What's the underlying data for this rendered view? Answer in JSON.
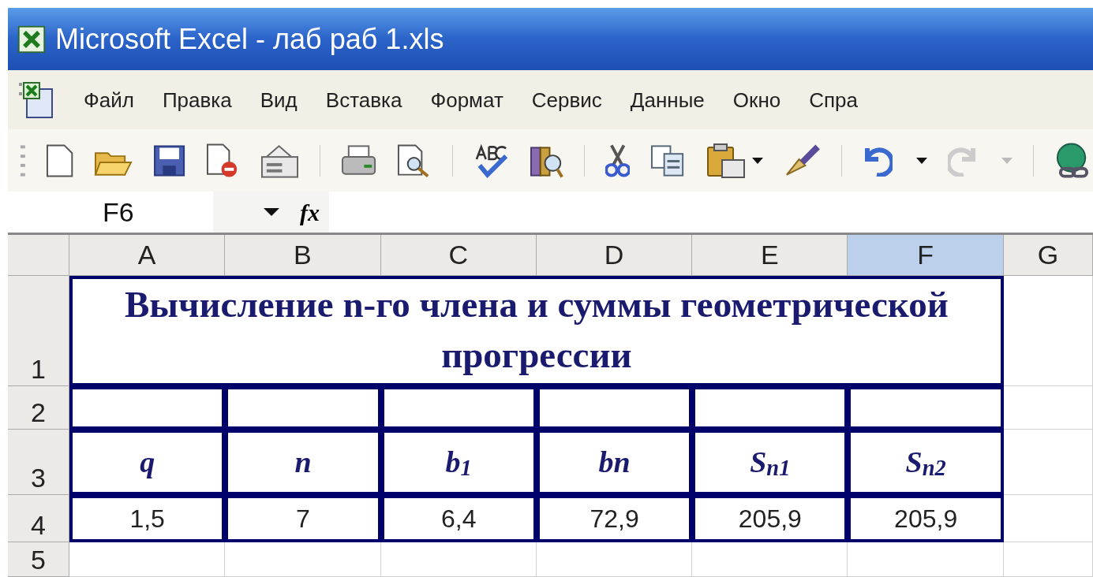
{
  "window": {
    "title": "Microsoft Excel - лаб раб 1.xls"
  },
  "menu": [
    {
      "label": "Файл"
    },
    {
      "label": "Правка"
    },
    {
      "label": "Вид"
    },
    {
      "label": "Вставка"
    },
    {
      "label": "Формат"
    },
    {
      "label": "Сервис"
    },
    {
      "label": "Данные"
    },
    {
      "label": "Окно"
    },
    {
      "label": "Спра"
    }
  ],
  "formula_bar": {
    "name_box": "F6",
    "fx_label": "fx"
  },
  "sheet": {
    "columns": [
      {
        "label": "A",
        "selected": false
      },
      {
        "label": "B",
        "selected": false
      },
      {
        "label": "C",
        "selected": false
      },
      {
        "label": "D",
        "selected": false
      },
      {
        "label": "E",
        "selected": false
      },
      {
        "label": "F",
        "selected": true
      },
      {
        "label": "G",
        "selected": false
      }
    ],
    "rows": [
      {
        "label": "1",
        "kind": "title",
        "title": "Вычисление n-го члена и суммы геометрической прогрессии"
      },
      {
        "label": "2",
        "kind": "blank_bordered"
      },
      {
        "label": "3",
        "kind": "header",
        "cells": [
          "q",
          "n",
          "b$_{1}$",
          "bn",
          "S$_{n1}$",
          "S$_{n2}$"
        ]
      },
      {
        "label": "4",
        "kind": "values",
        "cells": [
          "1,5",
          "7",
          "6,4",
          "72,9",
          "205,9",
          "205,9"
        ]
      },
      {
        "label": "5",
        "kind": "empty"
      }
    ]
  }
}
